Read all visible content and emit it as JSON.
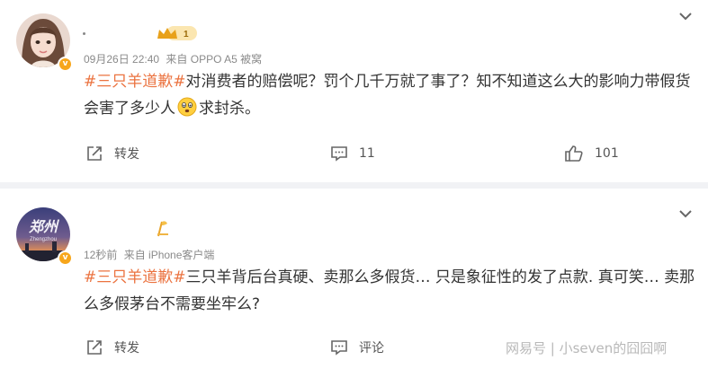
{
  "posts": [
    {
      "meta": {
        "time": "09月26日 22:40",
        "source": "来自 OPPO A5 被窝"
      },
      "level_badge": "1",
      "verify_badge": "v",
      "text": {
        "tag": "#三只羊道歉#",
        "line": "对消费者的赔偿呢？罚个几千万就了事了？知不知道这么大的影响力带假货会害了多少人",
        "tail": "求封杀。"
      },
      "actions": {
        "share": "转发",
        "comment": "11",
        "like": "101"
      }
    },
    {
      "meta": {
        "time": "12秒前",
        "source": "来自 iPhone客户端"
      },
      "avatar_text": "郑州",
      "avatar_subtext": "Zhengzhou",
      "verify_badge": "v",
      "text": {
        "tag": "#三只羊道歉#",
        "line": "三只羊背后台真硬、卖那么多假货… 只是象征性的发了点款. 真可笑… 卖那么多假茅台不需要坐牢么?"
      },
      "actions": {
        "share": "转发",
        "comment": "评论"
      }
    }
  ],
  "watermark": "网易号 | 小seven的囧囧啊",
  "colors": {
    "tag": "#eb7340",
    "badge": "#f7a61b",
    "divider": "#f1f2f5"
  }
}
